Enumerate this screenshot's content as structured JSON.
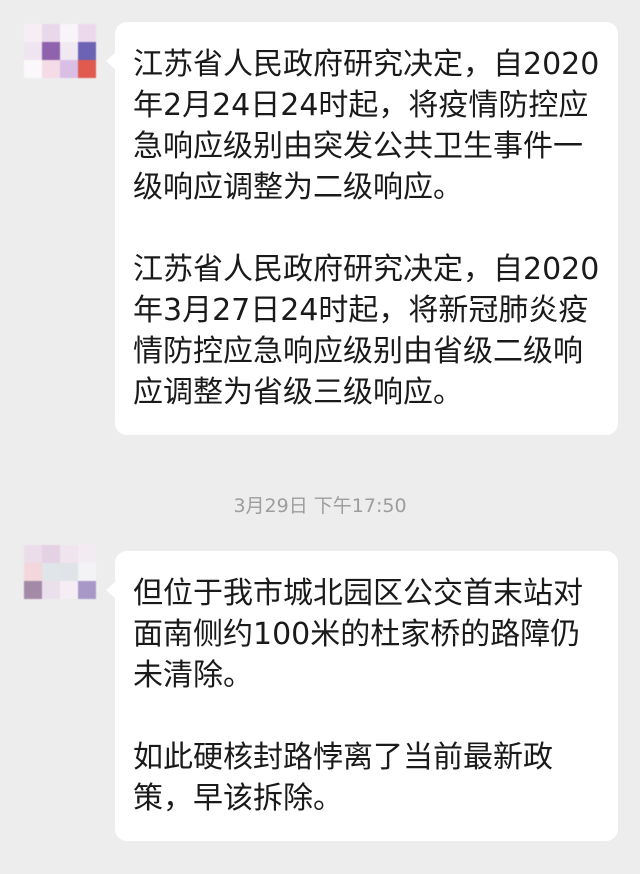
{
  "messages": [
    {
      "paragraphs": [
        "江苏省人民政府研究决定，自2020年2月24日24时起，将疫情防控应急响应级别由突发公共卫生事件一级响应调整为二级响应。",
        "江苏省人民政府研究决定，自2020年3月27日24时起，将新冠肺炎疫情防控应急响应级别由省级二级响应调整为省级三级响应。"
      ]
    },
    {
      "paragraphs": [
        "但位于我市城北园区公交首末站对面南侧约100米的杜家桥的路障仍未清除。",
        "如此硬核封路悖离了当前最新政策，早该拆除。"
      ]
    }
  ],
  "timestamp": "3月29日 下午17:50",
  "colors": {
    "background": "#ededed",
    "bubble": "#ffffff",
    "text": "#1a1a1a",
    "timestamp": "#9d9d9d"
  }
}
